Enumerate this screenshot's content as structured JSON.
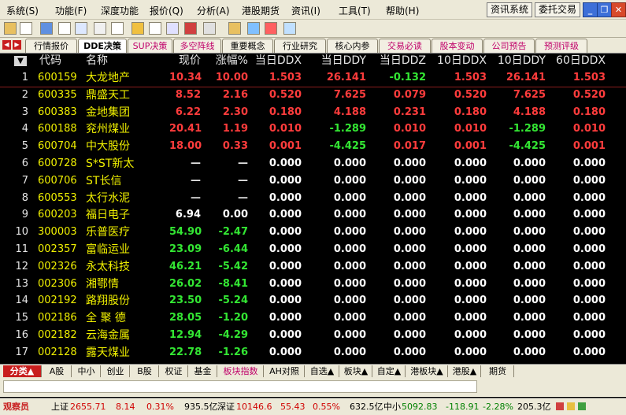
{
  "menu": {
    "items": [
      "系统(S)",
      "功能(F)",
      "深度功能",
      "报价(Q)",
      "分析(A)",
      "港股期货",
      "资讯(I)",
      "工具(T)",
      "帮助(H)"
    ],
    "info_system_label": "资讯系统",
    "trade_label": "委托交易"
  },
  "window_controls": {
    "min": "_",
    "restore": "❐",
    "close": "✕"
  },
  "tabs": [
    {
      "label": "行情报价",
      "style": "normal"
    },
    {
      "label": "DDE决策",
      "style": "selected"
    },
    {
      "label": "SUP决策",
      "style": "pink"
    },
    {
      "label": "多空阵线",
      "style": "pink"
    },
    {
      "label": "重要概念",
      "style": "normal"
    },
    {
      "label": "行业研究",
      "style": "normal"
    },
    {
      "label": "核心内参",
      "style": "normal"
    },
    {
      "label": "交易必读",
      "style": "pink"
    },
    {
      "label": "股本变动",
      "style": "pink"
    },
    {
      "label": "公司预告",
      "style": "pink"
    },
    {
      "label": "预测评级",
      "style": "pink"
    }
  ],
  "table": {
    "sort_indicator": "▼",
    "columns": {
      "code": "代码",
      "name": "名称",
      "price": "现价",
      "change_pct": "涨幅%",
      "ddx": "当日DDX",
      "ddy": "当日DDY",
      "ddz": "当日DDZ",
      "ddx10": "10日DDX",
      "ddy10": "10日DDY",
      "ddx60": "60日DDX"
    },
    "rows": [
      {
        "idx": "1",
        "code": "600159",
        "name": "大龙地产",
        "price": "10.34",
        "change_pct": "10.00",
        "ddx": "1.503",
        "ddy": "26.141",
        "ddz": "-0.132",
        "ddx10": "1.503",
        "ddy10": "26.141",
        "ddx60": "1.503",
        "price_color": "red",
        "change_color": "red"
      },
      {
        "idx": "2",
        "code": "600335",
        "name": "鼎盛天工",
        "price": "8.52",
        "change_pct": "2.16",
        "ddx": "0.520",
        "ddy": "7.625",
        "ddz": "0.079",
        "ddx10": "0.520",
        "ddy10": "7.625",
        "ddx60": "0.520",
        "price_color": "red",
        "change_color": "red"
      },
      {
        "idx": "3",
        "code": "600383",
        "name": "金地集团",
        "price": "6.22",
        "change_pct": "2.30",
        "ddx": "0.180",
        "ddy": "4.188",
        "ddz": "0.231",
        "ddx10": "0.180",
        "ddy10": "4.188",
        "ddx60": "0.180",
        "price_color": "red",
        "change_color": "red"
      },
      {
        "idx": "4",
        "code": "600188",
        "name": "兖州煤业",
        "price": "20.41",
        "change_pct": "1.19",
        "ddx": "0.010",
        "ddy": "-1.289",
        "ddz": "0.010",
        "ddx10": "0.010",
        "ddy10": "-1.289",
        "ddx60": "0.010",
        "price_color": "red",
        "change_color": "red"
      },
      {
        "idx": "5",
        "code": "600704",
        "name": "中大股份",
        "price": "18.00",
        "change_pct": "0.33",
        "ddx": "0.001",
        "ddy": "-4.425",
        "ddz": "0.017",
        "ddx10": "0.001",
        "ddy10": "-4.425",
        "ddx60": "0.001",
        "price_color": "red",
        "change_color": "red"
      },
      {
        "idx": "6",
        "code": "600728",
        "name": "S*ST新太",
        "price": "—",
        "change_pct": "—",
        "ddx": "0.000",
        "ddy": "0.000",
        "ddz": "0.000",
        "ddx10": "0.000",
        "ddy10": "0.000",
        "ddx60": "0.000",
        "price_color": "dash",
        "change_color": "dash"
      },
      {
        "idx": "7",
        "code": "600706",
        "name": "ST长信",
        "price": "—",
        "change_pct": "—",
        "ddx": "0.000",
        "ddy": "0.000",
        "ddz": "0.000",
        "ddx10": "0.000",
        "ddy10": "0.000",
        "ddx60": "0.000",
        "price_color": "dash",
        "change_color": "dash"
      },
      {
        "idx": "8",
        "code": "600553",
        "name": "太行水泥",
        "price": "—",
        "change_pct": "—",
        "ddx": "0.000",
        "ddy": "0.000",
        "ddz": "0.000",
        "ddx10": "0.000",
        "ddy10": "0.000",
        "ddx60": "0.000",
        "price_color": "dash",
        "change_color": "dash"
      },
      {
        "idx": "9",
        "code": "600203",
        "name": "福日电子",
        "price": "6.94",
        "change_pct": "0.00",
        "ddx": "0.000",
        "ddy": "0.000",
        "ddz": "0.000",
        "ddx10": "0.000",
        "ddy10": "0.000",
        "ddx60": "0.000",
        "price_color": "white",
        "change_color": "white"
      },
      {
        "idx": "10",
        "code": "300003",
        "name": "乐普医疗",
        "price": "54.90",
        "change_pct": "-2.47",
        "ddx": "0.000",
        "ddy": "0.000",
        "ddz": "0.000",
        "ddx10": "0.000",
        "ddy10": "0.000",
        "ddx60": "0.000",
        "price_color": "green",
        "change_color": "green"
      },
      {
        "idx": "11",
        "code": "002357",
        "name": "富临运业",
        "price": "23.09",
        "change_pct": "-6.44",
        "ddx": "0.000",
        "ddy": "0.000",
        "ddz": "0.000",
        "ddx10": "0.000",
        "ddy10": "0.000",
        "ddx60": "0.000",
        "price_color": "green",
        "change_color": "green"
      },
      {
        "idx": "12",
        "code": "002326",
        "name": "永太科技",
        "price": "46.21",
        "change_pct": "-5.42",
        "ddx": "0.000",
        "ddy": "0.000",
        "ddz": "0.000",
        "ddx10": "0.000",
        "ddy10": "0.000",
        "ddx60": "0.000",
        "price_color": "green",
        "change_color": "green"
      },
      {
        "idx": "13",
        "code": "002306",
        "name": "湘鄂情",
        "price": "26.02",
        "change_pct": "-8.41",
        "ddx": "0.000",
        "ddy": "0.000",
        "ddz": "0.000",
        "ddx10": "0.000",
        "ddy10": "0.000",
        "ddx60": "0.000",
        "price_color": "green",
        "change_color": "green"
      },
      {
        "idx": "14",
        "code": "002192",
        "name": "路翔股份",
        "price": "23.50",
        "change_pct": "-5.24",
        "ddx": "0.000",
        "ddy": "0.000",
        "ddz": "0.000",
        "ddx10": "0.000",
        "ddy10": "0.000",
        "ddx60": "0.000",
        "price_color": "green",
        "change_color": "green"
      },
      {
        "idx": "15",
        "code": "002186",
        "name": "全 聚 德",
        "price": "28.05",
        "change_pct": "-1.20",
        "ddx": "0.000",
        "ddy": "0.000",
        "ddz": "0.000",
        "ddx10": "0.000",
        "ddy10": "0.000",
        "ddx60": "0.000",
        "price_color": "green",
        "change_color": "green"
      },
      {
        "idx": "16",
        "code": "002182",
        "name": "云海金属",
        "price": "12.94",
        "change_pct": "-4.29",
        "ddx": "0.000",
        "ddy": "0.000",
        "ddz": "0.000",
        "ddx10": "0.000",
        "ddy10": "0.000",
        "ddx60": "0.000",
        "price_color": "green",
        "change_color": "green"
      },
      {
        "idx": "17",
        "code": "002128",
        "name": "露天煤业",
        "price": "22.78",
        "change_pct": "-1.26",
        "ddx": "0.000",
        "ddy": "0.000",
        "ddz": "0.000",
        "ddx10": "0.000",
        "ddy10": "0.000",
        "ddx60": "0.000",
        "price_color": "green",
        "change_color": "green"
      }
    ]
  },
  "category_tabs": [
    {
      "label": "分类▲",
      "style": "first"
    },
    {
      "label": "A股",
      "style": "normal"
    },
    {
      "label": "中小",
      "style": "normal"
    },
    {
      "label": "创业",
      "style": "normal"
    },
    {
      "label": "B股",
      "style": "normal"
    },
    {
      "label": "权证",
      "style": "normal"
    },
    {
      "label": "基金",
      "style": "normal"
    },
    {
      "label": "板块指数",
      "style": "pink"
    },
    {
      "label": "AH对照",
      "style": "normal"
    },
    {
      "label": "自选▲",
      "style": "normal"
    },
    {
      "label": "板块▲",
      "style": "normal"
    },
    {
      "label": "自定▲",
      "style": "normal"
    },
    {
      "label": "港板块▲",
      "style": "normal"
    },
    {
      "label": "港股▲",
      "style": "normal"
    },
    {
      "label": "期货",
      "style": "normal"
    }
  ],
  "status": {
    "observer": "观察员",
    "sh_label": "上证",
    "sh_index": "2655.71",
    "sh_change": "8.14",
    "sh_pct": "0.31%",
    "sh_amount": "935.5亿",
    "sz_label": "深证",
    "sz_index": "10146.6",
    "sz_change": "55.43",
    "sz_pct": "0.55%",
    "sz_amount": "632.5亿",
    "zx_label": "中小",
    "zx_index": "5092.83",
    "zx_change": "-118.91",
    "zx_pct": "-2.28%",
    "zx_amount": "205.3亿"
  },
  "colors": {
    "bg": "#000000",
    "up": "#ff3c3c",
    "down": "#33e633",
    "code": "#f0f000"
  }
}
